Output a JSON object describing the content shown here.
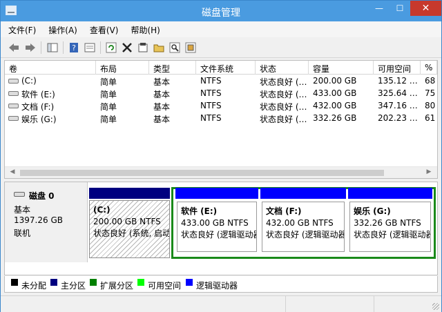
{
  "window": {
    "title": "磁盘管理",
    "min": "—",
    "max": "☐",
    "close": "✕"
  },
  "menu": [
    "文件(F)",
    "操作(A)",
    "查看(V)",
    "帮助(H)"
  ],
  "toolbar": {
    "icons": [
      "back-icon",
      "forward-icon",
      "show-hide-console-tree-icon",
      "help-icon",
      "console-view-icon",
      "refresh-icon",
      "delete-icon",
      "properties-icon",
      "open-icon",
      "find-icon",
      "rescan-icon"
    ]
  },
  "columns": [
    "卷",
    "布局",
    "类型",
    "文件系统",
    "状态",
    "容量",
    "可用空间",
    "%"
  ],
  "volumes": [
    {
      "name": "(C:)",
      "layout": "简单",
      "type": "基本",
      "fs": "NTFS",
      "status": "状态良好 (…",
      "capacity": "200.00 GB",
      "free": "135.12 …",
      "pct": "68"
    },
    {
      "name": "软件 (E:)",
      "layout": "简单",
      "type": "基本",
      "fs": "NTFS",
      "status": "状态良好 (…",
      "capacity": "433.00 GB",
      "free": "325.64 …",
      "pct": "75"
    },
    {
      "name": "文档 (F:)",
      "layout": "简单",
      "type": "基本",
      "fs": "NTFS",
      "status": "状态良好 (…",
      "capacity": "432.00 GB",
      "free": "347.16 …",
      "pct": "80"
    },
    {
      "name": "娱乐 (G:)",
      "layout": "简单",
      "type": "基本",
      "fs": "NTFS",
      "status": "状态良好 (…",
      "capacity": "332.26 GB",
      "free": "202.23 …",
      "pct": "61"
    }
  ],
  "disk": {
    "name": "磁盘 0",
    "type": "基本",
    "size": "1397.26 GB",
    "state": "联机"
  },
  "partitions": [
    {
      "title": "(C:)",
      "size": "200.00 GB NTFS",
      "status": "状态良好 (系统, 启动"
    },
    {
      "title": "软件  (E:)",
      "size": "433.00 GB NTFS",
      "status": "状态良好 (逻辑驱动器"
    },
    {
      "title": "文档  (F:)",
      "size": "432.00 GB NTFS",
      "status": "状态良好 (逻辑驱动器"
    },
    {
      "title": "娱乐  (G:)",
      "size": "332.26 GB NTFS",
      "status": "状态良好 (逻辑驱动器"
    }
  ],
  "legend": [
    {
      "label": "未分配",
      "color": "#000000"
    },
    {
      "label": "主分区",
      "color": "#000080"
    },
    {
      "label": "扩展分区",
      "color": "#008000"
    },
    {
      "label": "可用空间",
      "color": "#00ff00"
    },
    {
      "label": "逻辑驱动器",
      "color": "#0000ff"
    }
  ],
  "colors": {
    "primary_bar": "#000080",
    "logical_bar": "#0000ff",
    "extended_border": "#1a8a1a",
    "titlebar": "#4a9be0"
  }
}
